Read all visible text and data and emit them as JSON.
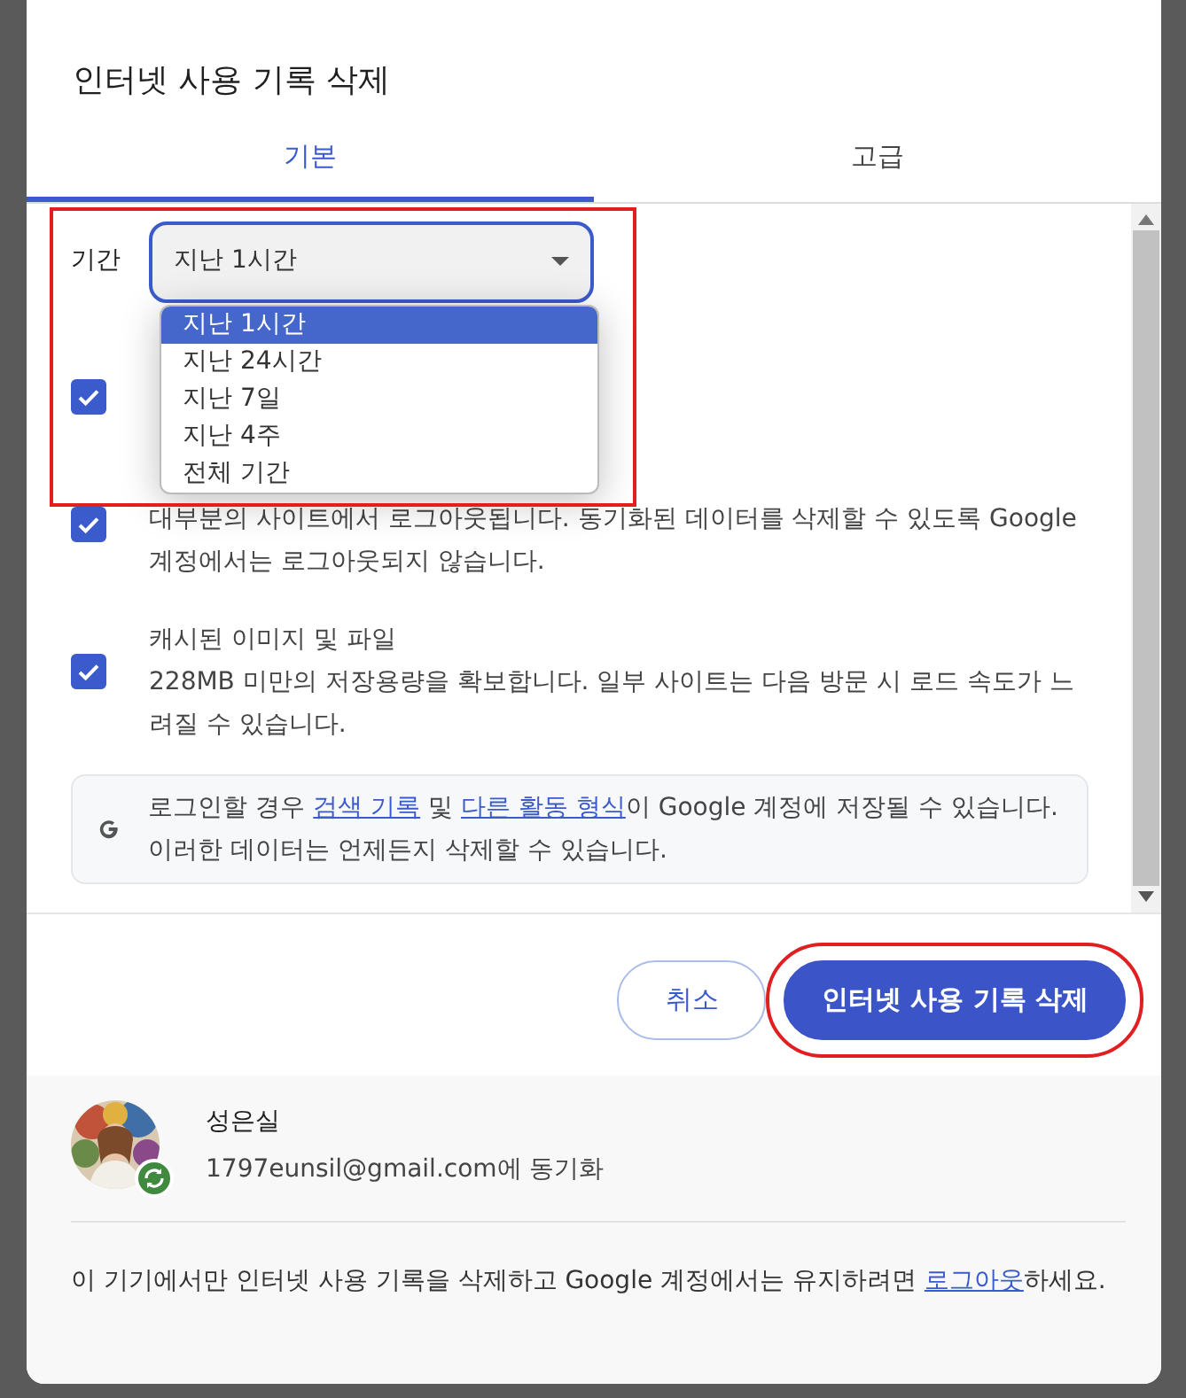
{
  "window": {
    "title": "인터넷 사용 기록 삭제"
  },
  "tabs": [
    {
      "label": "기본",
      "selected": true
    },
    {
      "label": "고급",
      "selected": false
    }
  ],
  "period": {
    "label": "기간",
    "value": "지난 1시간",
    "highlighted": true,
    "expanded": true,
    "options": [
      {
        "label": "지난 1시간",
        "selected": true
      },
      {
        "label": "지난 24시간",
        "selected": false
      },
      {
        "label": "지난 7일",
        "selected": false
      },
      {
        "label": "지난 4주",
        "selected": false
      },
      {
        "label": "전체 기간",
        "selected": false
      }
    ]
  },
  "items": [
    {
      "checked": true
    },
    {
      "description": "대부분의 사이트에서 로그아웃됩니다. 동기화된 데이터를 삭제할 수 있도록 Google 계정에서는 로그아웃되지 않습니다.",
      "checked": true
    },
    {
      "title": "캐시된 이미지 및 파일",
      "description": "228MB 미만의 저장용량을 확보합니다. 일부 사이트는 다음 방문 시 로드 속도가 느려질 수 있습니다.",
      "checked": true
    }
  ],
  "info": [
    {
      "text": "로그인할 경우 ",
      "kind": "text"
    },
    {
      "text": "검색 기록",
      "kind": "link"
    },
    {
      "text": " 및 ",
      "kind": "text"
    },
    {
      "text": "다른 활동 형식",
      "kind": "link"
    },
    {
      "text": "이 Google 계정에 저장될 수 있습니다. 이러한 데이터는 언제든지 삭제할 수 있습니다.",
      "kind": "text"
    }
  ],
  "buttons": [
    {
      "label": "취소",
      "kind": "secondary"
    },
    {
      "label": "인터넷 사용 기록 삭제",
      "kind": "primary",
      "highlighted": true
    }
  ],
  "account": {
    "name": "성은실",
    "sync_text": "1797eunsil@gmail.com에 동기화",
    "synced": true
  },
  "note": [
    {
      "text": "이 기기에서만 인터넷 사용 기록을 삭제하고 Google 계정에서는 유지하려면 ",
      "kind": "text"
    },
    {
      "text": "로그아웃",
      "kind": "link"
    },
    {
      "text": "하세요.",
      "kind": "text"
    }
  ]
}
